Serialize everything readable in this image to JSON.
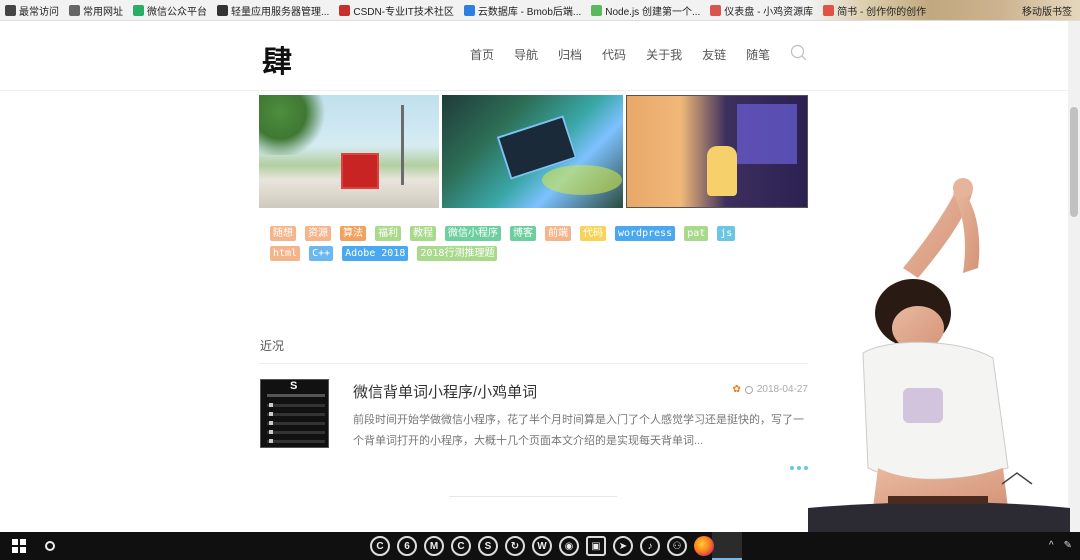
{
  "bookmarks": {
    "items": [
      {
        "label": "最常访问",
        "icon": "gear-icon",
        "color": "#444444"
      },
      {
        "label": "常用网址",
        "icon": "folder-icon",
        "color": "#666666"
      },
      {
        "label": "微信公众平台",
        "icon": "wechat-icon",
        "color": "#2aae67"
      },
      {
        "label": "轻量应用服务器管理...",
        "icon": "cloud-bracket-icon",
        "color": "#333333"
      },
      {
        "label": "CSDN-专业IT技术社区",
        "icon": "csdn-icon",
        "color": "#c9302c"
      },
      {
        "label": "云数据库 - Bmob后端...",
        "icon": "bmob-icon",
        "color": "#2f7fe0"
      },
      {
        "label": "Node.js 创建第一个...",
        "icon": "page-icon",
        "color": "#5cb85c"
      },
      {
        "label": "仪表盘 - 小鸡资源库",
        "icon": "dashboard-icon",
        "color": "#d9534f"
      },
      {
        "label": "简书 - 创作你的创作",
        "icon": "jianshu-icon",
        "color": "#e05244"
      }
    ],
    "mobile_label": "移动版书签"
  },
  "site": {
    "logo": "肆",
    "nav": [
      "首页",
      "导航",
      "归档",
      "代码",
      "关于我",
      "友链",
      "随笔"
    ]
  },
  "tags": {
    "row1": [
      {
        "label": "随想",
        "color": "#f6b48a"
      },
      {
        "label": "资源",
        "color": "#f6b48a"
      },
      {
        "label": "算法",
        "color": "#f2a25f"
      },
      {
        "label": "福利",
        "color": "#a9d98a"
      },
      {
        "label": "教程",
        "color": "#a9d98a"
      },
      {
        "label": "微信小程序",
        "color": "#6dcf9f"
      },
      {
        "label": "博客",
        "color": "#6dcf9f"
      },
      {
        "label": "前端",
        "color": "#f6b48a"
      },
      {
        "label": "代码",
        "color": "#f7d35a"
      },
      {
        "label": "wordpress",
        "color": "#4aa8ee"
      },
      {
        "label": "pat",
        "color": "#a9d98a"
      },
      {
        "label": "js",
        "color": "#6bc6e4"
      }
    ],
    "row2": [
      {
        "label": "html",
        "color": "#f6b48a"
      },
      {
        "label": "C++",
        "color": "#6bb8ee"
      },
      {
        "label": "Adobe 2018",
        "color": "#4aa8ee"
      },
      {
        "label": "2018行测推理题",
        "color": "#a9d98a"
      }
    ]
  },
  "section": {
    "title": "近况"
  },
  "post": {
    "title": "微信背单词小程序/小鸡单词",
    "date": "2018-04-27",
    "excerpt": "前段时间开始学做微信小程序，花了半个月时间算是入门了个人感觉学习还是挺快的，写了一个背单词打开的小程序，大概十几个页面本文介绍的是实现每天背单词..."
  },
  "taskbar": {
    "apps": [
      {
        "name": "ccleaner-icon",
        "glyph": "C"
      },
      {
        "name": "netease-music-icon",
        "glyph": "6"
      },
      {
        "name": "meitu-icon",
        "glyph": "M"
      },
      {
        "name": "c-app-icon",
        "glyph": "C"
      },
      {
        "name": "s-app-icon",
        "glyph": "S"
      },
      {
        "name": "sync-icon",
        "glyph": "↻"
      },
      {
        "name": "wechat-icon",
        "glyph": "W"
      },
      {
        "name": "chrome-icon",
        "glyph": "◉"
      },
      {
        "name": "file-explorer-icon",
        "glyph": "▣"
      },
      {
        "name": "telegram-icon",
        "glyph": "➤"
      },
      {
        "name": "netease-cloud-icon",
        "glyph": "♪"
      },
      {
        "name": "game-icon",
        "glyph": "⚇"
      },
      {
        "name": "firefox-icon",
        "glyph": ""
      }
    ]
  }
}
